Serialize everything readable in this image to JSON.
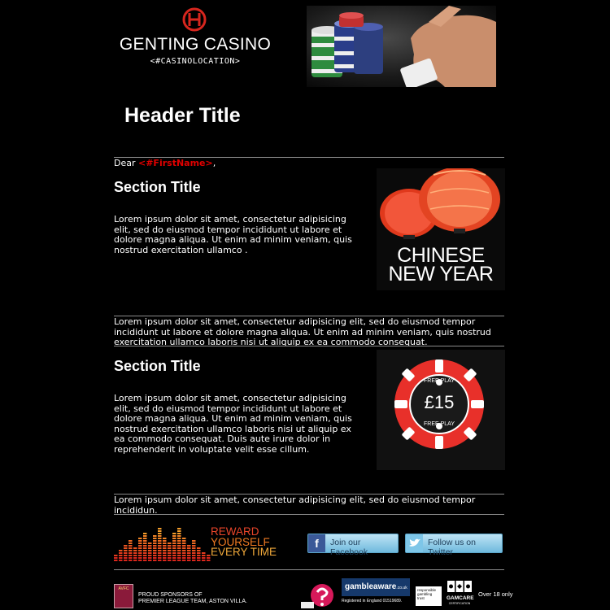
{
  "logo": {
    "brand": "GENTING CASINO",
    "location": "<#CASINOLOCATION>",
    "accent_color": "#d7261e"
  },
  "header": {
    "title": "Header Title"
  },
  "greeting": {
    "prefix": "Dear ",
    "first_name": "<#FirstName>",
    "suffix": ","
  },
  "section1": {
    "title": "Section Title",
    "body": "Lorem ipsum dolor sit amet, consectetur adipisicing elit, sed do eiusmod tempor incididunt ut labore et dolore magna aliqua. Ut enim ad minim veniam, quis nostrud exercitation ullamco .",
    "image_text": [
      "CHINESE",
      "NEW YEAR"
    ]
  },
  "divider_text1": "Lorem ipsum dolor sit amet, consectetur adipisicing elit, sed do eiusmod tempor incididunt ut labore et dolore magna aliqua. Ut enim ad minim veniam, quis nostrud exercitation ullamco laboris nisi ut aliquip ex ea commodo consequat.",
  "section2": {
    "title": "Section Title",
    "body": "Lorem ipsum dolor sit amet, consectetur adipisicing elit, sed do eiusmod tempor incididunt ut labore et dolore magna aliqua. Ut enim ad minim veniam, quis nostrud exercitation ullamco laboris nisi ut aliquip ex ea commodo consequat. Duis aute irure dolor in reprehenderit in voluptate velit esse cillum.",
    "chip": {
      "amount": "£15",
      "top_text": "FREE PLAY",
      "bottom_text": "FREE PLAY",
      "color": "#e8302a"
    }
  },
  "divider_text2": "Lorem ipsum dolor sit amet, consectetur adipisicing elit, sed do eiusmod tempor incididun.",
  "reward": {
    "line1": "REWARD",
    "line2": "YOURSELF",
    "line3": "EVERY TIME"
  },
  "social": {
    "facebook_label": "Join our Facebook",
    "twitter_label": "Follow us on Twitter"
  },
  "footer": {
    "crest_text": "AVFC",
    "sponsor_line1": "PROUD SPONSORS OF",
    "sponsor_line2": "PREMIER LEAGUE TEAM, ASTON VILLA.",
    "gambleaware": "gambleaware",
    "gambleaware_suffix": ".co.uk",
    "registered": "Registered in England 01519689.",
    "responsible": "responsible gambling trust",
    "gamcare": "GAMCARE",
    "gamcare_sub": "CERTIFICATION",
    "age": "Over 18 only"
  }
}
